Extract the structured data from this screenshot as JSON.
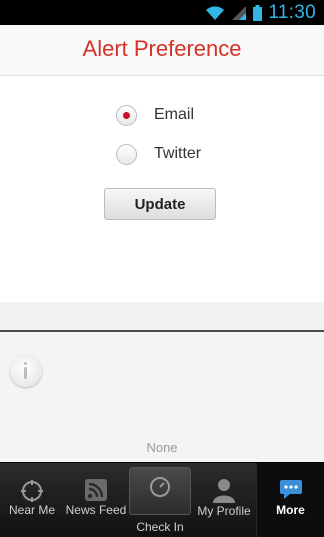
{
  "status_bar": {
    "time": "11:30",
    "icons": [
      "wifi-icon",
      "signal-icon",
      "battery-icon"
    ]
  },
  "header": {
    "title": "Alert Preference"
  },
  "preferences": {
    "options": [
      {
        "label": "Email",
        "selected": true
      },
      {
        "label": "Twitter",
        "selected": false
      }
    ],
    "update_label": "Update"
  },
  "lower_panel": {
    "icon": "info-icon",
    "empty_text": "None"
  },
  "bottom_nav": {
    "items": [
      {
        "label": "Near Me",
        "icon": "compass-icon",
        "active": false
      },
      {
        "label": "News Feed",
        "icon": "rss-icon",
        "active": false
      },
      {
        "label": "Check In",
        "icon": "check-in-icon",
        "active": false
      },
      {
        "label": "My Profile",
        "icon": "profile-icon",
        "active": false
      },
      {
        "label": "More",
        "icon": "chat-bubble-icon",
        "active": true
      }
    ]
  },
  "colors": {
    "title_red": "#d43227",
    "radio_selected": "#c8102e",
    "status_blue": "#33b5e5",
    "more_icon_blue": "#3a8fd8"
  }
}
